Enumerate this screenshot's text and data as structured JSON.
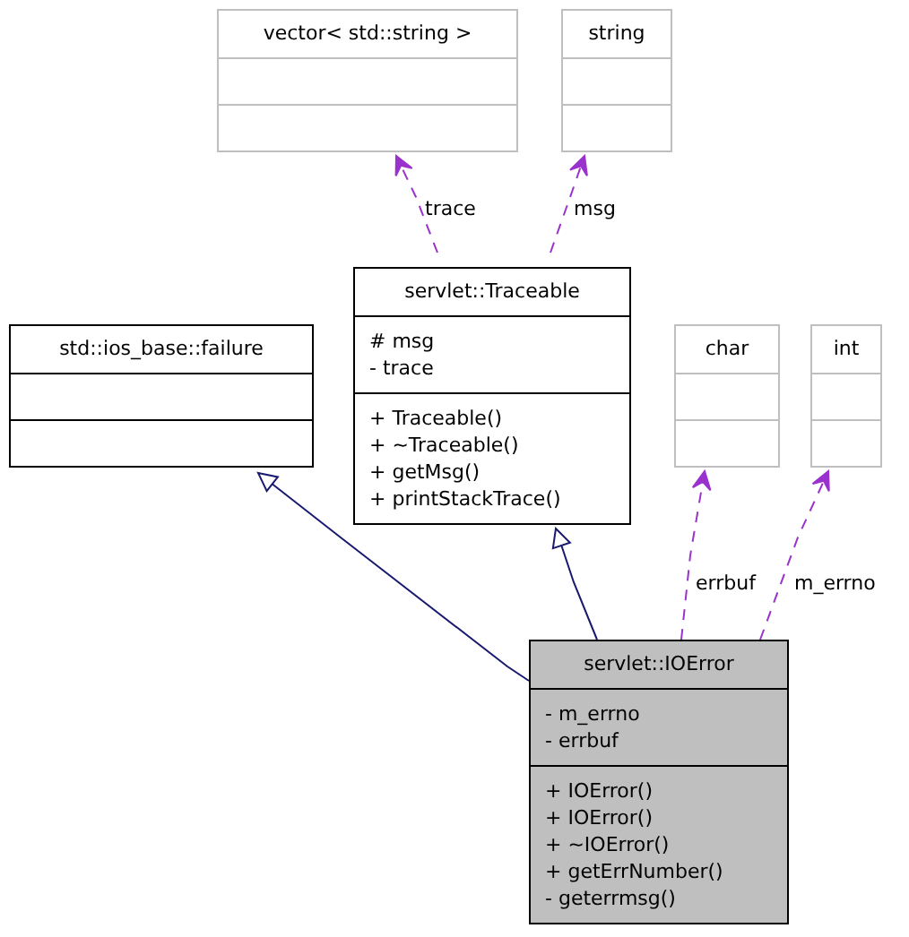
{
  "classes": [
    {
      "name": "vector< std::string >",
      "kind": "external"
    },
    {
      "name": "string",
      "kind": "external"
    },
    {
      "name": "std::ios_base::failure",
      "kind": "class"
    },
    {
      "name": "servlet::Traceable",
      "kind": "class",
      "attributes": [
        "# msg",
        "- trace"
      ],
      "methods": [
        "+ Traceable()",
        "+ ~Traceable()",
        "+ getMsg()",
        "+ printStackTrace()"
      ]
    },
    {
      "name": "char",
      "kind": "external"
    },
    {
      "name": "int",
      "kind": "external"
    },
    {
      "name": "servlet::IOError",
      "kind": "focus",
      "attributes": [
        "- m_errno",
        "- errbuf"
      ],
      "methods": [
        "+ IOError()",
        "+ IOError()",
        "+ ~IOError()",
        "+ getErrNumber()",
        "- geterrmsg()"
      ]
    }
  ],
  "relations": [
    {
      "kind": "usage",
      "label": "trace"
    },
    {
      "kind": "usage",
      "label": "msg"
    },
    {
      "kind": "usage",
      "label": "errbuf"
    },
    {
      "kind": "usage",
      "label": "m_errno"
    },
    {
      "kind": "inheritance"
    },
    {
      "kind": "inheritance"
    }
  ]
}
